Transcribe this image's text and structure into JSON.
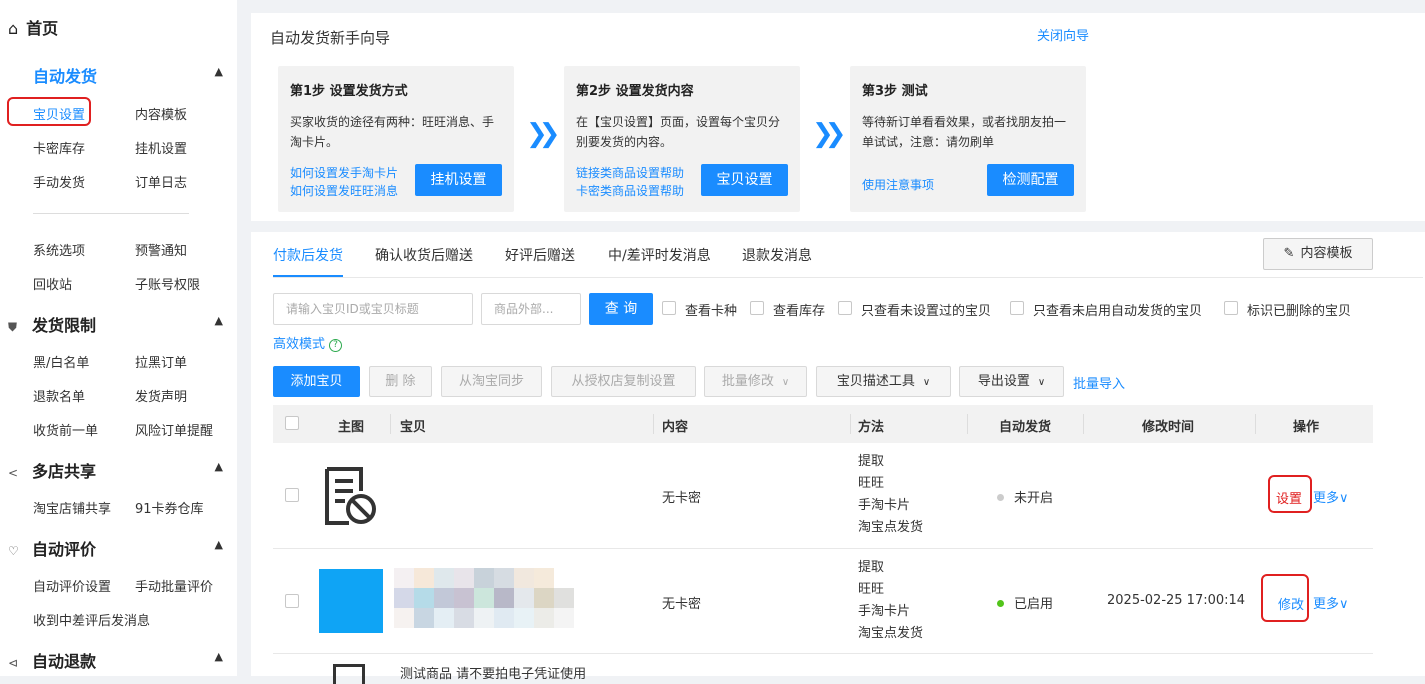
{
  "sidebar": {
    "home": "首页",
    "sections": {
      "auto_ship": {
        "label": "自动发货",
        "items": [
          "宝贝设置",
          "内容模板",
          "卡密库存",
          "挂机设置",
          "手动发货",
          "订单日志",
          "系统选项",
          "预警通知",
          "回收站",
          "子账号权限"
        ]
      },
      "ship_limit": {
        "label": "发货限制",
        "items": [
          "黑/白名单",
          "拉黑订单",
          "退款名单",
          "发货声明",
          "收货前一单",
          "风险订单提醒"
        ]
      },
      "multi_shop": {
        "label": "多店共享",
        "items": [
          "淘宝店铺共享",
          "91卡券仓库"
        ]
      },
      "auto_review": {
        "label": "自动评价",
        "items": [
          "自动评价设置",
          "手动批量评价",
          "收到中差评后发消息"
        ]
      },
      "auto_refund": {
        "label": "自动退款"
      }
    }
  },
  "guide": {
    "title": "自动发货新手向导",
    "close": "关闭向导",
    "steps": [
      {
        "title": "第1步 设置发货方式",
        "desc": "买家收货的途径有两种：旺旺消息、手淘卡片。",
        "links": [
          "如何设置发手淘卡片",
          "如何设置发旺旺消息"
        ],
        "button": "挂机设置"
      },
      {
        "title": "第2步 设置发货内容",
        "desc": "在【宝贝设置】页面，设置每个宝贝分别要发货的内容。",
        "links": [
          "链接类商品设置帮助",
          "卡密类商品设置帮助"
        ],
        "button": "宝贝设置"
      },
      {
        "title": "第3步 测试",
        "desc": "等待新订单看看效果，或者找朋友拍一单试试，注意：请勿刷单",
        "links": [
          "使用注意事项"
        ],
        "button": "检测配置"
      }
    ]
  },
  "tabs": [
    "付款后发货",
    "确认收货后赠送",
    "好评后赠送",
    "中/差评时发消息",
    "退款发消息"
  ],
  "content_template_btn": "内容模板",
  "filters": {
    "search_placeholder": "请输入宝贝ID或宝贝标题",
    "outer_placeholder": "商品外部...",
    "query": "查 询",
    "checks": [
      "查看卡种",
      "查看库存",
      "只查看未设置过的宝贝",
      "只查看未启用自动发货的宝贝",
      "标识已删除的宝贝"
    ],
    "efficient_mode": "高效模式"
  },
  "actions": {
    "add": "添加宝贝",
    "delete": "删 除",
    "sync": "从淘宝同步",
    "copy": "从授权店复制设置",
    "batch_modify": "批量修改",
    "desc_tool": "宝贝描述工具",
    "export": "导出设置",
    "batch_import": "批量导入"
  },
  "table": {
    "headers": [
      "主图",
      "宝贝",
      "内容",
      "方法",
      "自动发货",
      "修改时间",
      "操作"
    ],
    "rows": [
      {
        "content": "无卡密",
        "methods": [
          "提取",
          "旺旺",
          "手淘卡片",
          "淘宝点发货"
        ],
        "status": "未开启",
        "time": "",
        "op": "设置",
        "more": "更多∨"
      },
      {
        "content": "无卡密",
        "methods": [
          "提取",
          "旺旺",
          "手淘卡片",
          "淘宝点发货"
        ],
        "status": "已启用",
        "time": "2025-02-25 17:00:14",
        "op": "修改",
        "more": "更多∨"
      },
      {
        "title": "测试商品 请不要拍电子凭证使用"
      }
    ]
  },
  "colors": {
    "primary": "#1a8cff",
    "highlight": "#e02020",
    "enabled": "#52c41a",
    "disabled": "#cccccc"
  }
}
